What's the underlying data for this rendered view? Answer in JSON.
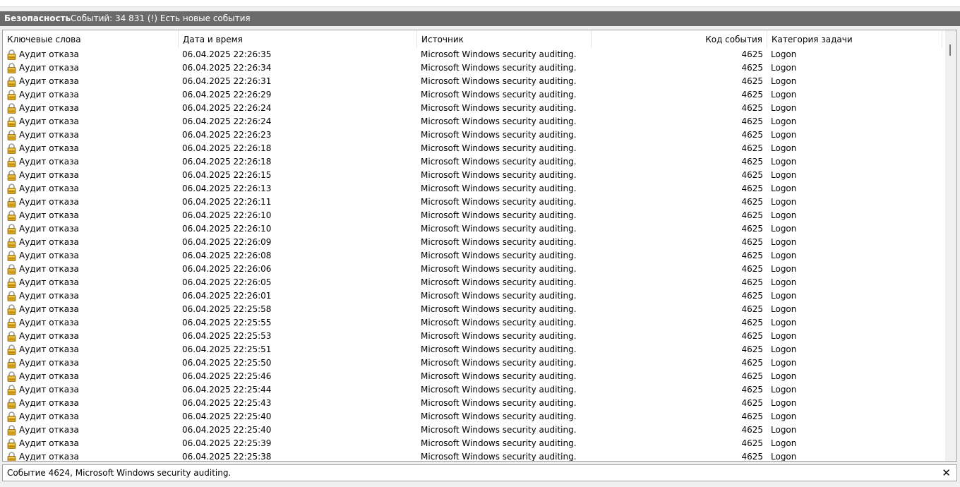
{
  "title_bar": {
    "log_name": "Безопасность",
    "event_count": "Событий: 34 831 (!) Есть новые события"
  },
  "columns": [
    {
      "key": "keywords",
      "label": "Ключевые слова"
    },
    {
      "key": "datetime",
      "label": "Дата и время"
    },
    {
      "key": "source",
      "label": "Источник"
    },
    {
      "key": "event_id",
      "label": "Код события"
    },
    {
      "key": "category",
      "label": "Категория задачи"
    }
  ],
  "row_icon": "lock-icon",
  "icon_color": "#d9a520",
  "events": [
    {
      "keywords": "Аудит отказа",
      "datetime": "06.04.2025 22:26:35",
      "source": "Microsoft Windows security auditing.",
      "event_id": "4625",
      "category": "Logon"
    },
    {
      "keywords": "Аудит отказа",
      "datetime": "06.04.2025 22:26:34",
      "source": "Microsoft Windows security auditing.",
      "event_id": "4625",
      "category": "Logon"
    },
    {
      "keywords": "Аудит отказа",
      "datetime": "06.04.2025 22:26:31",
      "source": "Microsoft Windows security auditing.",
      "event_id": "4625",
      "category": "Logon"
    },
    {
      "keywords": "Аудит отказа",
      "datetime": "06.04.2025 22:26:29",
      "source": "Microsoft Windows security auditing.",
      "event_id": "4625",
      "category": "Logon"
    },
    {
      "keywords": "Аудит отказа",
      "datetime": "06.04.2025 22:26:24",
      "source": "Microsoft Windows security auditing.",
      "event_id": "4625",
      "category": "Logon"
    },
    {
      "keywords": "Аудит отказа",
      "datetime": "06.04.2025 22:26:24",
      "source": "Microsoft Windows security auditing.",
      "event_id": "4625",
      "category": "Logon"
    },
    {
      "keywords": "Аудит отказа",
      "datetime": "06.04.2025 22:26:23",
      "source": "Microsoft Windows security auditing.",
      "event_id": "4625",
      "category": "Logon"
    },
    {
      "keywords": "Аудит отказа",
      "datetime": "06.04.2025 22:26:18",
      "source": "Microsoft Windows security auditing.",
      "event_id": "4625",
      "category": "Logon"
    },
    {
      "keywords": "Аудит отказа",
      "datetime": "06.04.2025 22:26:18",
      "source": "Microsoft Windows security auditing.",
      "event_id": "4625",
      "category": "Logon"
    },
    {
      "keywords": "Аудит отказа",
      "datetime": "06.04.2025 22:26:15",
      "source": "Microsoft Windows security auditing.",
      "event_id": "4625",
      "category": "Logon"
    },
    {
      "keywords": "Аудит отказа",
      "datetime": "06.04.2025 22:26:13",
      "source": "Microsoft Windows security auditing.",
      "event_id": "4625",
      "category": "Logon"
    },
    {
      "keywords": "Аудит отказа",
      "datetime": "06.04.2025 22:26:11",
      "source": "Microsoft Windows security auditing.",
      "event_id": "4625",
      "category": "Logon"
    },
    {
      "keywords": "Аудит отказа",
      "datetime": "06.04.2025 22:26:10",
      "source": "Microsoft Windows security auditing.",
      "event_id": "4625",
      "category": "Logon"
    },
    {
      "keywords": "Аудит отказа",
      "datetime": "06.04.2025 22:26:10",
      "source": "Microsoft Windows security auditing.",
      "event_id": "4625",
      "category": "Logon"
    },
    {
      "keywords": "Аудит отказа",
      "datetime": "06.04.2025 22:26:09",
      "source": "Microsoft Windows security auditing.",
      "event_id": "4625",
      "category": "Logon"
    },
    {
      "keywords": "Аудит отказа",
      "datetime": "06.04.2025 22:26:08",
      "source": "Microsoft Windows security auditing.",
      "event_id": "4625",
      "category": "Logon"
    },
    {
      "keywords": "Аудит отказа",
      "datetime": "06.04.2025 22:26:06",
      "source": "Microsoft Windows security auditing.",
      "event_id": "4625",
      "category": "Logon"
    },
    {
      "keywords": "Аудит отказа",
      "datetime": "06.04.2025 22:26:05",
      "source": "Microsoft Windows security auditing.",
      "event_id": "4625",
      "category": "Logon"
    },
    {
      "keywords": "Аудит отказа",
      "datetime": "06.04.2025 22:26:01",
      "source": "Microsoft Windows security auditing.",
      "event_id": "4625",
      "category": "Logon"
    },
    {
      "keywords": "Аудит отказа",
      "datetime": "06.04.2025 22:25:58",
      "source": "Microsoft Windows security auditing.",
      "event_id": "4625",
      "category": "Logon"
    },
    {
      "keywords": "Аудит отказа",
      "datetime": "06.04.2025 22:25:55",
      "source": "Microsoft Windows security auditing.",
      "event_id": "4625",
      "category": "Logon"
    },
    {
      "keywords": "Аудит отказа",
      "datetime": "06.04.2025 22:25:53",
      "source": "Microsoft Windows security auditing.",
      "event_id": "4625",
      "category": "Logon"
    },
    {
      "keywords": "Аудит отказа",
      "datetime": "06.04.2025 22:25:51",
      "source": "Microsoft Windows security auditing.",
      "event_id": "4625",
      "category": "Logon"
    },
    {
      "keywords": "Аудит отказа",
      "datetime": "06.04.2025 22:25:50",
      "source": "Microsoft Windows security auditing.",
      "event_id": "4625",
      "category": "Logon"
    },
    {
      "keywords": "Аудит отказа",
      "datetime": "06.04.2025 22:25:46",
      "source": "Microsoft Windows security auditing.",
      "event_id": "4625",
      "category": "Logon"
    },
    {
      "keywords": "Аудит отказа",
      "datetime": "06.04.2025 22:25:44",
      "source": "Microsoft Windows security auditing.",
      "event_id": "4625",
      "category": "Logon"
    },
    {
      "keywords": "Аудит отказа",
      "datetime": "06.04.2025 22:25:43",
      "source": "Microsoft Windows security auditing.",
      "event_id": "4625",
      "category": "Logon"
    },
    {
      "keywords": "Аудит отказа",
      "datetime": "06.04.2025 22:25:40",
      "source": "Microsoft Windows security auditing.",
      "event_id": "4625",
      "category": "Logon"
    },
    {
      "keywords": "Аудит отказа",
      "datetime": "06.04.2025 22:25:40",
      "source": "Microsoft Windows security auditing.",
      "event_id": "4625",
      "category": "Logon"
    },
    {
      "keywords": "Аудит отказа",
      "datetime": "06.04.2025 22:25:39",
      "source": "Microsoft Windows security auditing.",
      "event_id": "4625",
      "category": "Logon"
    },
    {
      "keywords": "Аудит отказа",
      "datetime": "06.04.2025 22:25:38",
      "source": "Microsoft Windows security auditing.",
      "event_id": "4625",
      "category": "Logon"
    }
  ],
  "status_bar": {
    "text": "Событие 4624, Microsoft Windows security auditing.",
    "close_glyph": "✕"
  }
}
